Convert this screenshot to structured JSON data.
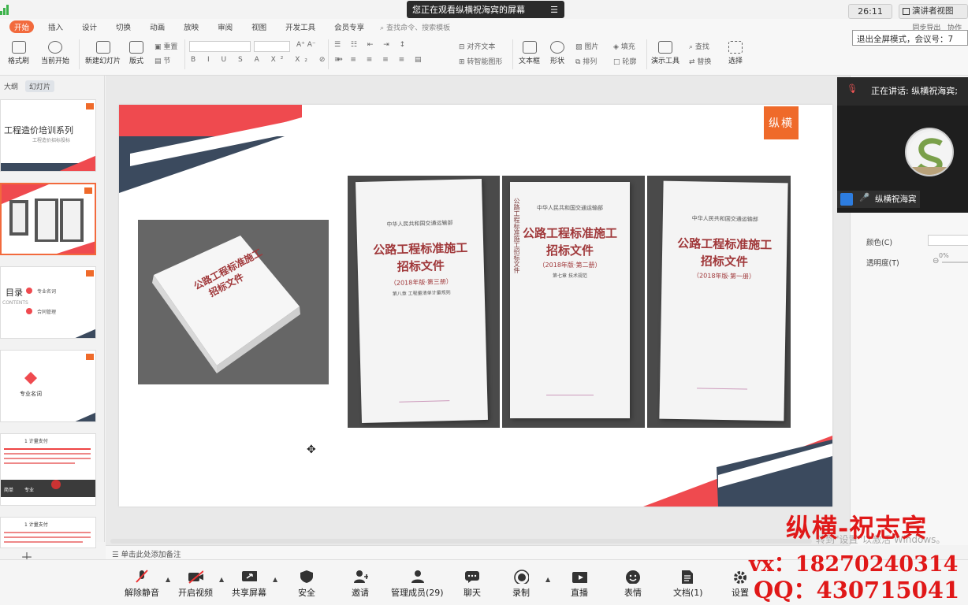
{
  "ribbon": {
    "tabs": [
      "开始",
      "插入",
      "设计",
      "切换",
      "动画",
      "放映",
      "审阅",
      "视图",
      "开发工具",
      "会员专享"
    ],
    "search": "查找命令、搜索模板",
    "share_label": "同步导出",
    "collab_label": "协作",
    "buttons": {
      "format_painter": "格式刷",
      "from_current": "当前开始",
      "new_slide": "新建幻灯片",
      "layout": "版式",
      "reset": "重置",
      "section": "节",
      "align_text": "对齐文本",
      "smart_shape": "转智能图形",
      "textbox": "文本框",
      "shape": "形状",
      "picture": "图片",
      "arrange": "排列",
      "fill": "填充",
      "outline": "轮廓",
      "present_tool": "演示工具",
      "find": "查找",
      "replace": "替换",
      "select": "选择"
    }
  },
  "overlay": {
    "watching_banner": "您正在观看纵横祝海宾的屏幕",
    "timer": "26:11",
    "presenter_view": "演讲者视图",
    "exit_fullscreen_tip": "退出全屏模式，会议号：7"
  },
  "left_panel": {
    "tab_outline": "大纲",
    "tab_slides": "幻灯片",
    "thumbs": [
      {
        "title": "工程造价培训系列",
        "subtitle": "工程造价招标投标"
      },
      {
        "title": ""
      },
      {
        "title": "目录",
        "subtitle": "CONTENTS",
        "items": [
          "专业名词",
          "合同管理"
        ]
      },
      {
        "title": "专业名词"
      },
      {
        "title": "1 计量支付",
        "footer": [
          "简单",
          "专业"
        ]
      },
      {
        "title": "1 计量支付"
      }
    ]
  },
  "slide": {
    "brand": "纵横",
    "books": [
      {
        "publisher": "中华人民共和国交通运输部",
        "title1": "公路工程标准施工",
        "title2": "招标文件",
        "edition": "（2018年版·第三册）",
        "sub": "第八章 工程量清单计量规则"
      },
      {
        "publisher": "中华人民共和国交通运输部",
        "title1": "公路工程标准施工",
        "title2": "招标文件",
        "edition": "（2018年版·第二册）",
        "sub": "第七章 技术规范",
        "spine": "公路工程标准施工招标文件"
      },
      {
        "publisher": "中华人民共和国交通运输部",
        "title1": "公路工程标准施工",
        "title2": "招标文件",
        "edition": "（2018年版·第一册）",
        "sub": ""
      }
    ],
    "photo_book": {
      "title1": "公路工程标准施工",
      "title2": "招标文件"
    }
  },
  "notes_placeholder": "单击此处添加备注",
  "right_panel": {
    "color_label": "颜色(C)",
    "transparency_label": "透明度(T)",
    "transparency_value": "0%"
  },
  "video": {
    "speaking": "正在讲话: 纵横祝海宾;",
    "participant": "纵横祝海宾"
  },
  "meeting_bar": {
    "unmute": "解除静音",
    "video": "开启视频",
    "share": "共享屏幕",
    "security": "安全",
    "invite": "邀请",
    "members": "管理成员(29)",
    "chat": "聊天",
    "record": "录制",
    "live": "直播",
    "reaction": "表情",
    "docs": "文档(1)",
    "settings": "设置"
  },
  "watermark": {
    "name": "纵横-祝志宾",
    "vx": "vx：18270240314",
    "qq": "QQ：430715041",
    "win_activate": "转到\"设置\"以激活 Windows。"
  },
  "colors": {
    "accent_orange": "#f26a3d",
    "brand_red": "#ef4a4f",
    "brand_navy": "#3b4a5e",
    "watermark_red": "#e01818"
  }
}
